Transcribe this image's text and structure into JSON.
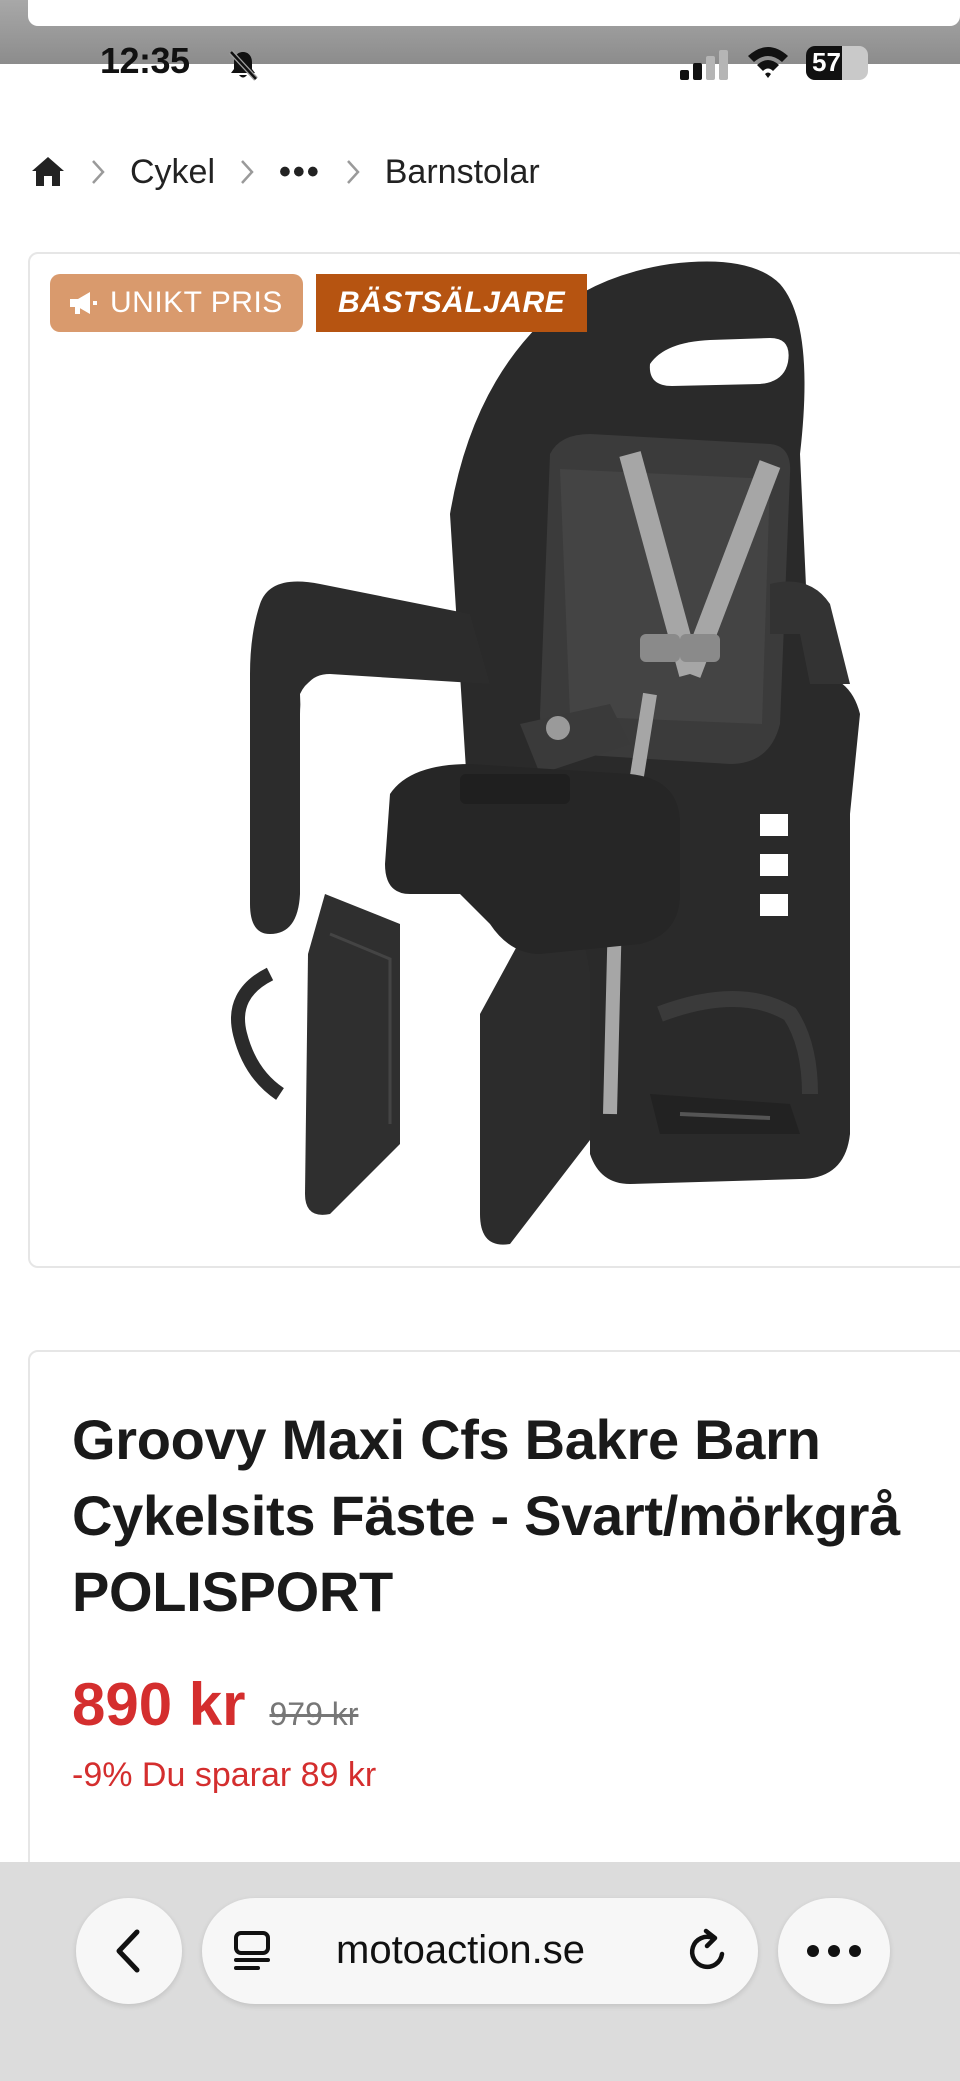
{
  "status_bar": {
    "time": "12:35",
    "battery": "57"
  },
  "breadcrumb": {
    "items": [
      "Cykel",
      "•••",
      "Barnstolar"
    ]
  },
  "product": {
    "badges": {
      "unique_price": "UNIKT PRIS",
      "bestseller": "BÄSTSÄLJARE"
    },
    "title": "Groovy Maxi Cfs Bakre Barn Cykelsits Fäste - Svart/mörkgrå POLISPORT",
    "price": "890 kr",
    "old_price": "979 kr",
    "savings": "-9% Du sparar 89 kr"
  },
  "browser": {
    "url": "motoaction.se"
  },
  "colors": {
    "price_red": "#d42e2e",
    "badge_unique": "#d99a6d",
    "badge_bestseller": "#b65411"
  }
}
